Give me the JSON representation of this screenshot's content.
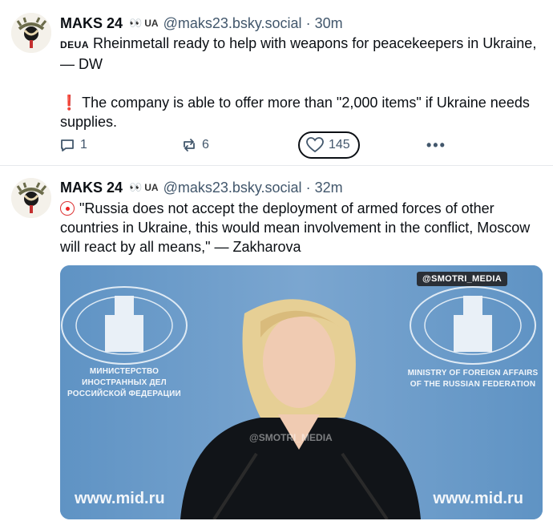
{
  "posts": [
    {
      "author": "MAKS 24",
      "badge_eyes": "👀",
      "badge_flag": "UA",
      "handle": "@maks23.bsky.social",
      "separator": "·",
      "time": "30m",
      "line1_tag": "DEUA",
      "line1_text": " Rheinmetall ready to help with weapons for peacekeepers in Ukraine, — DW",
      "line2_icon": "❗",
      "line2_text": " The company is able to offer more than \"2,000 items\" if Ukraine needs supplies.",
      "reply_count": "1",
      "repost_count": "6",
      "like_count": "145",
      "more_label": "•••"
    },
    {
      "author": "MAKS 24",
      "badge_eyes": "👀",
      "badge_flag": "UA",
      "handle": "@maks23.bsky.social",
      "separator": "·",
      "time": "32m",
      "text": "\"Russia does not accept the deployment of armed forces of other countries in Ukraine, this would mean involvement in the conflict, Moscow will react by all means,\" — Zakharova",
      "media": {
        "watermark": "@SMOTRI_MEDIA",
        "left_sign": "МИНИСТЕРСТВО ИНОСТРАННЫХ ДЕЛ\nРОССИЙСКОЙ ФЕДЕРАЦИИ",
        "right_sign": "MINISTRY OF FOREIGN AFFAIRS\nOF THE RUSSIAN FEDERATION",
        "url_left": "www.mid.ru",
        "url_right": "www.mid.ru",
        "center_watermark": "@SMOTRI_MEDIA"
      }
    }
  ],
  "icons": {
    "avatar": "avatar-image",
    "reply": "reply-icon",
    "repost": "repost-icon",
    "like": "heart-icon",
    "more": "more-icon",
    "clown": "clown-emoji-icon"
  },
  "colors": {
    "text": "#0b0f14",
    "muted": "#42576c",
    "divider": "#e6e9ec",
    "media_bg": "#6b9bc7"
  }
}
